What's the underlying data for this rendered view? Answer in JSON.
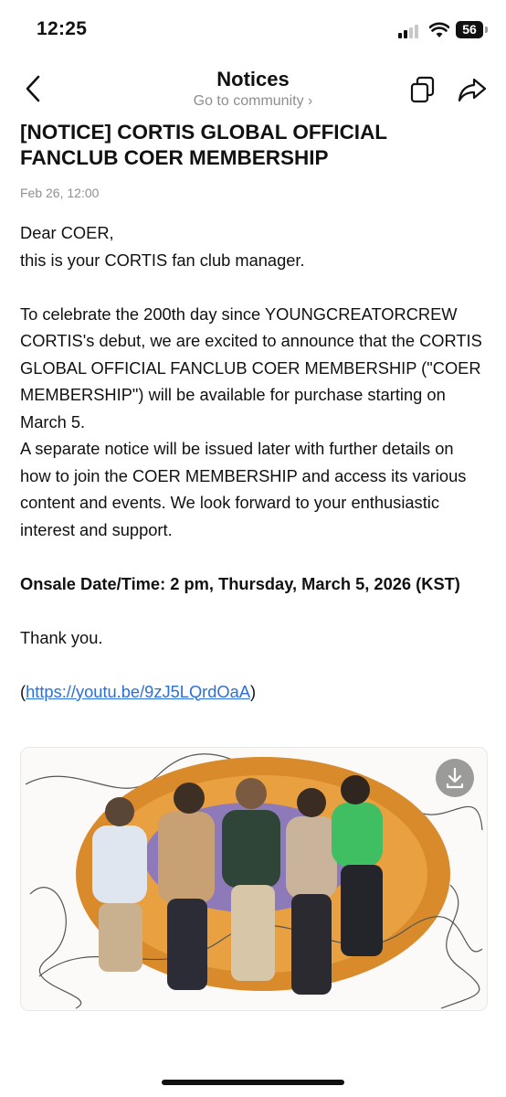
{
  "status_bar": {
    "time": "12:25",
    "battery": "56"
  },
  "nav": {
    "title": "Notices",
    "subtitle": "Go to community",
    "subtitle_chevron": "›"
  },
  "post": {
    "title": "[NOTICE] CORTIS GLOBAL OFFICIAL FANCLUB COER MEMBERSHIP",
    "date": "Feb 26, 12:00",
    "greeting_1": "Dear COER,",
    "greeting_2": "this is your CORTIS fan club manager.",
    "para_1": "To celebrate the 200th day since YOUNGCREATORCREW CORTIS's debut, we are excited to announce that the CORTIS GLOBAL OFFICIAL FANCLUB COER MEMBERSHIP (\"COER MEMBERSHIP\") will be available for purchase starting on March 5.",
    "para_2": "A separate notice will be issued later with further details on how to join the COER MEMBERSHIP and access its various content and events. We look forward to your enthusiastic interest and support.",
    "onsale": "Onsale Date/Time: 2 pm, Thursday, March 5, 2026 (KST)",
    "thanks": "Thank you.",
    "link_open": "(",
    "link_url": "https://youtu.be/9zJ5LQrdOaA",
    "link_close": ")"
  },
  "icons": {
    "back": "chevron-left-icon",
    "copy": "copy-icon",
    "share": "share-arrow-icon",
    "download": "download-icon"
  },
  "colors": {
    "link": "#2a6fdb",
    "muted": "#8e8e93",
    "rug": "#d98a2b"
  }
}
